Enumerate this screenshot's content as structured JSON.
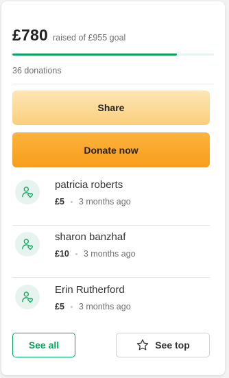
{
  "summary": {
    "amount_raised": "£780",
    "goal_text": "raised of £955 goal",
    "progress_fraction": 0.8168,
    "donations_count": "36 donations"
  },
  "actions": {
    "share_label": "Share",
    "donate_label": "Donate now"
  },
  "donors": [
    {
      "name": "patricia roberts",
      "amount": "£5",
      "time": "3 months ago",
      "icon": "donor-heart-icon"
    },
    {
      "name": "sharon banzhaf",
      "amount": "£10",
      "time": "3 months ago",
      "icon": "donor-heart-icon"
    },
    {
      "name": "Erin Rutherford",
      "amount": "£5",
      "time": "3 months ago",
      "icon": "donor-heart-icon"
    }
  ],
  "footer": {
    "see_all_label": "See all",
    "see_top_label": "See top",
    "see_top_icon": "star-icon"
  },
  "colors": {
    "accent_green": "#02a95c",
    "donate_orange": "#f79d1c",
    "share_peach": "#fbcf7c"
  }
}
